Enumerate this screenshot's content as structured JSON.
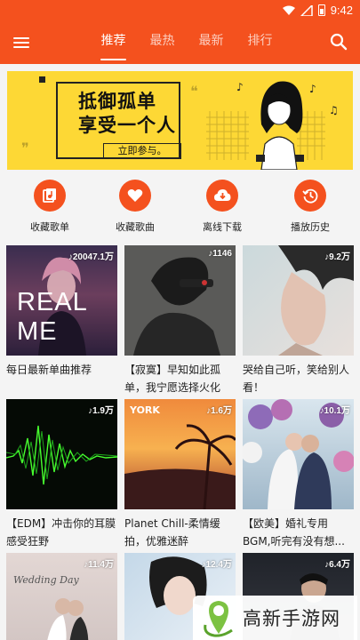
{
  "status_bar": {
    "time": "9:42"
  },
  "app_bar": {
    "tabs": [
      {
        "label": "推荐",
        "active": true
      },
      {
        "label": "最热",
        "active": false
      },
      {
        "label": "最新",
        "active": false
      },
      {
        "label": "排行",
        "active": false
      }
    ],
    "menu_icon": "menu-icon",
    "search_icon": "search-icon",
    "colors": {
      "primary": "#f4511e",
      "tab_text": "#ffffff"
    }
  },
  "banner": {
    "line1": "抵御孤单",
    "line2": "享受一个人",
    "cta": "立即参与。",
    "background": "#fdd835"
  },
  "quick_actions": [
    {
      "label": "收藏歌单",
      "icon": "playlist-icon"
    },
    {
      "label": "收藏歌曲",
      "icon": "heart-icon"
    },
    {
      "label": "离线下载",
      "icon": "cloud-download-icon"
    },
    {
      "label": "播放历史",
      "icon": "history-icon"
    }
  ],
  "playlists": [
    {
      "count": "♪20047.1万",
      "title": "每日最新单曲推荐",
      "cover_text": "REAL ME"
    },
    {
      "count": "♪1146",
      "title": "【寂寞】早知如此孤单，我宁愿选择火化",
      "cover_text": ""
    },
    {
      "count": "♪9.2万",
      "title": "哭给自己听，笑给别人看！",
      "cover_text": ""
    },
    {
      "count": "♪1.9万",
      "title": "【EDM】冲击你的耳膜 感受狂野",
      "cover_text": ""
    },
    {
      "count": "♪1.6万",
      "title": "Planet Chill-柔情缓拍，优雅迷醉",
      "cover_text": "YORK"
    },
    {
      "count": "♪10.1万",
      "title": "【欧美】婚礼专用BGM,听完有没有想...",
      "cover_text": ""
    },
    {
      "count": "♪11.4万",
      "title": "",
      "cover_text": "Wedding Day"
    },
    {
      "count": "♪12.4万",
      "title": "",
      "cover_text": ""
    },
    {
      "count": "♪6.4万",
      "title": "",
      "cover_text": ""
    }
  ],
  "watermark": {
    "text": "高新手游网"
  }
}
